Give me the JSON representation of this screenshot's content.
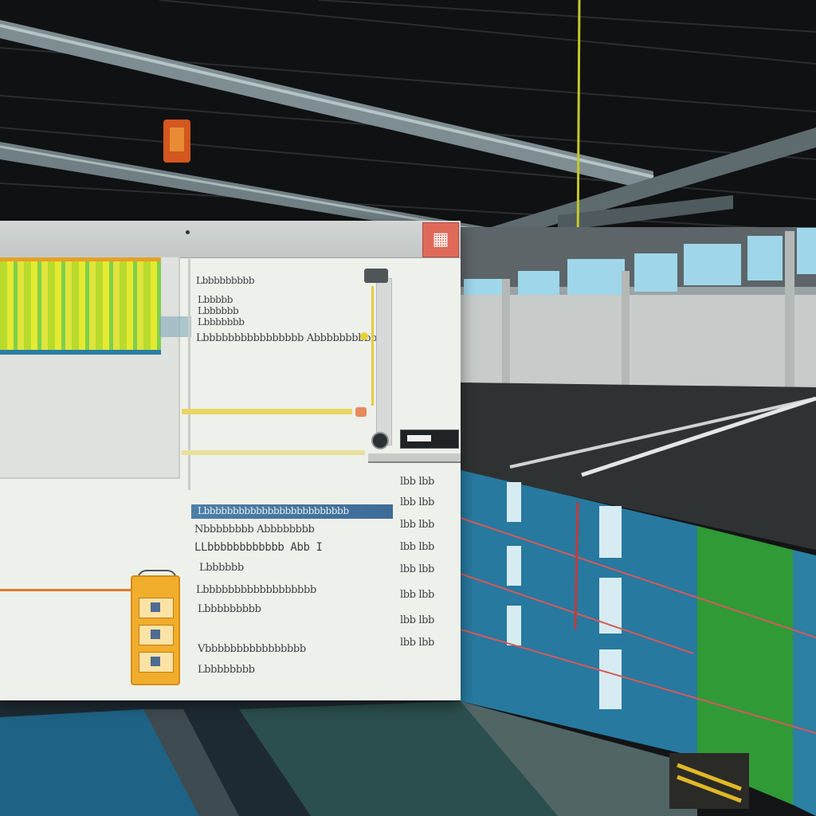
{
  "panel": {
    "heading": "Lbbbbbbbbb",
    "sub_lines": [
      "Lbbbbb",
      "Lbbbbbb",
      "Lbbbbbbb"
    ],
    "long_label": "Lbbbbbbbbbbbbbbbb Abbbbbbbbbbb",
    "section_header": "Lbbbbbbbbbbbbbbbbbbbbbbbbb",
    "body_lines": [
      "Nbbbbbbbb Abbbbbbbb",
      "LLbbbbbbbbbbbb Abb I",
      "Lbbbbbb",
      "Lbbbbbbbbbbbbbbbbbb",
      "Lbbbbbbbbb",
      "Vbbbbbbbbbbbbbbbb",
      "Lbbbbbbbb"
    ],
    "right_column": [
      "lbb lbb",
      "lbb lbb",
      "lbb lbb",
      "lbb lbb",
      "lbb lbb",
      "lbb lbb",
      "lbb lbb",
      "lbb lbb"
    ]
  },
  "colors": {
    "accent_yellow": "#e8d660",
    "accent_orange": "#e4782e",
    "header_blue": "#4d7fa8",
    "close_red": "#e06a5a"
  },
  "icons": {
    "close": "close-icon",
    "badge": "id-badge-icon",
    "device": "device-icon"
  }
}
